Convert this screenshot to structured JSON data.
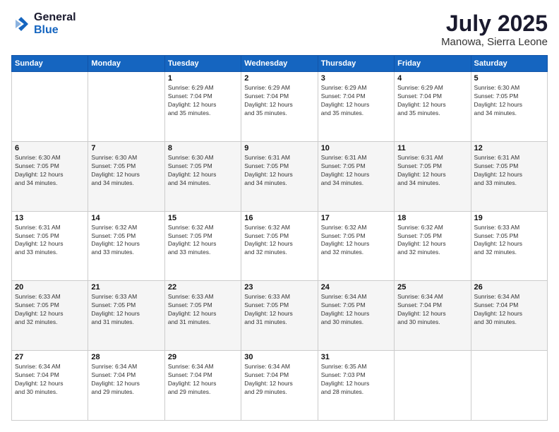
{
  "logo": {
    "general": "General",
    "blue": "Blue"
  },
  "title": "July 2025",
  "location": "Manowa, Sierra Leone",
  "days_header": [
    "Sunday",
    "Monday",
    "Tuesday",
    "Wednesday",
    "Thursday",
    "Friday",
    "Saturday"
  ],
  "weeks": [
    [
      {
        "day": "",
        "info": ""
      },
      {
        "day": "",
        "info": ""
      },
      {
        "day": "1",
        "info": "Sunrise: 6:29 AM\nSunset: 7:04 PM\nDaylight: 12 hours\nand 35 minutes."
      },
      {
        "day": "2",
        "info": "Sunrise: 6:29 AM\nSunset: 7:04 PM\nDaylight: 12 hours\nand 35 minutes."
      },
      {
        "day": "3",
        "info": "Sunrise: 6:29 AM\nSunset: 7:04 PM\nDaylight: 12 hours\nand 35 minutes."
      },
      {
        "day": "4",
        "info": "Sunrise: 6:29 AM\nSunset: 7:04 PM\nDaylight: 12 hours\nand 35 minutes."
      },
      {
        "day": "5",
        "info": "Sunrise: 6:30 AM\nSunset: 7:05 PM\nDaylight: 12 hours\nand 34 minutes."
      }
    ],
    [
      {
        "day": "6",
        "info": "Sunrise: 6:30 AM\nSunset: 7:05 PM\nDaylight: 12 hours\nand 34 minutes."
      },
      {
        "day": "7",
        "info": "Sunrise: 6:30 AM\nSunset: 7:05 PM\nDaylight: 12 hours\nand 34 minutes."
      },
      {
        "day": "8",
        "info": "Sunrise: 6:30 AM\nSunset: 7:05 PM\nDaylight: 12 hours\nand 34 minutes."
      },
      {
        "day": "9",
        "info": "Sunrise: 6:31 AM\nSunset: 7:05 PM\nDaylight: 12 hours\nand 34 minutes."
      },
      {
        "day": "10",
        "info": "Sunrise: 6:31 AM\nSunset: 7:05 PM\nDaylight: 12 hours\nand 34 minutes."
      },
      {
        "day": "11",
        "info": "Sunrise: 6:31 AM\nSunset: 7:05 PM\nDaylight: 12 hours\nand 34 minutes."
      },
      {
        "day": "12",
        "info": "Sunrise: 6:31 AM\nSunset: 7:05 PM\nDaylight: 12 hours\nand 33 minutes."
      }
    ],
    [
      {
        "day": "13",
        "info": "Sunrise: 6:31 AM\nSunset: 7:05 PM\nDaylight: 12 hours\nand 33 minutes."
      },
      {
        "day": "14",
        "info": "Sunrise: 6:32 AM\nSunset: 7:05 PM\nDaylight: 12 hours\nand 33 minutes."
      },
      {
        "day": "15",
        "info": "Sunrise: 6:32 AM\nSunset: 7:05 PM\nDaylight: 12 hours\nand 33 minutes."
      },
      {
        "day": "16",
        "info": "Sunrise: 6:32 AM\nSunset: 7:05 PM\nDaylight: 12 hours\nand 32 minutes."
      },
      {
        "day": "17",
        "info": "Sunrise: 6:32 AM\nSunset: 7:05 PM\nDaylight: 12 hours\nand 32 minutes."
      },
      {
        "day": "18",
        "info": "Sunrise: 6:32 AM\nSunset: 7:05 PM\nDaylight: 12 hours\nand 32 minutes."
      },
      {
        "day": "19",
        "info": "Sunrise: 6:33 AM\nSunset: 7:05 PM\nDaylight: 12 hours\nand 32 minutes."
      }
    ],
    [
      {
        "day": "20",
        "info": "Sunrise: 6:33 AM\nSunset: 7:05 PM\nDaylight: 12 hours\nand 32 minutes."
      },
      {
        "day": "21",
        "info": "Sunrise: 6:33 AM\nSunset: 7:05 PM\nDaylight: 12 hours\nand 31 minutes."
      },
      {
        "day": "22",
        "info": "Sunrise: 6:33 AM\nSunset: 7:05 PM\nDaylight: 12 hours\nand 31 minutes."
      },
      {
        "day": "23",
        "info": "Sunrise: 6:33 AM\nSunset: 7:05 PM\nDaylight: 12 hours\nand 31 minutes."
      },
      {
        "day": "24",
        "info": "Sunrise: 6:34 AM\nSunset: 7:05 PM\nDaylight: 12 hours\nand 30 minutes."
      },
      {
        "day": "25",
        "info": "Sunrise: 6:34 AM\nSunset: 7:04 PM\nDaylight: 12 hours\nand 30 minutes."
      },
      {
        "day": "26",
        "info": "Sunrise: 6:34 AM\nSunset: 7:04 PM\nDaylight: 12 hours\nand 30 minutes."
      }
    ],
    [
      {
        "day": "27",
        "info": "Sunrise: 6:34 AM\nSunset: 7:04 PM\nDaylight: 12 hours\nand 30 minutes."
      },
      {
        "day": "28",
        "info": "Sunrise: 6:34 AM\nSunset: 7:04 PM\nDaylight: 12 hours\nand 29 minutes."
      },
      {
        "day": "29",
        "info": "Sunrise: 6:34 AM\nSunset: 7:04 PM\nDaylight: 12 hours\nand 29 minutes."
      },
      {
        "day": "30",
        "info": "Sunrise: 6:34 AM\nSunset: 7:04 PM\nDaylight: 12 hours\nand 29 minutes."
      },
      {
        "day": "31",
        "info": "Sunrise: 6:35 AM\nSunset: 7:03 PM\nDaylight: 12 hours\nand 28 minutes."
      },
      {
        "day": "",
        "info": ""
      },
      {
        "day": "",
        "info": ""
      }
    ]
  ]
}
